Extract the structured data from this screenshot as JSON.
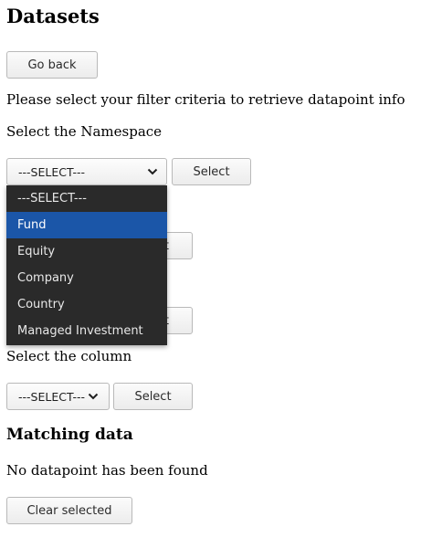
{
  "page": {
    "title": "Datasets",
    "go_back": "Go back",
    "instructions": "Please select your filter criteria to retrieve datapoint info"
  },
  "namespace": {
    "label": "Select the Namespace",
    "selected": "---SELECT---",
    "button": "Select",
    "dropdown_open": true,
    "options": [
      "---SELECT---",
      "Fund",
      "Equity",
      "Company",
      "Country",
      "Managed Investment"
    ],
    "highlighted_option": "Fund"
  },
  "hidden_filters": {
    "button_partial_1": "t",
    "button_partial_2": "t"
  },
  "column": {
    "label": "Select the column",
    "selected": "---SELECT---",
    "button": "Select"
  },
  "results": {
    "heading": "Matching data",
    "message": "No datapoint has been found",
    "clear_button": "Clear selected"
  },
  "colors": {
    "dropdown_bg": "#2a2a2a",
    "dropdown_highlight": "#1b56a8",
    "button_border": "#b9b9b9"
  }
}
